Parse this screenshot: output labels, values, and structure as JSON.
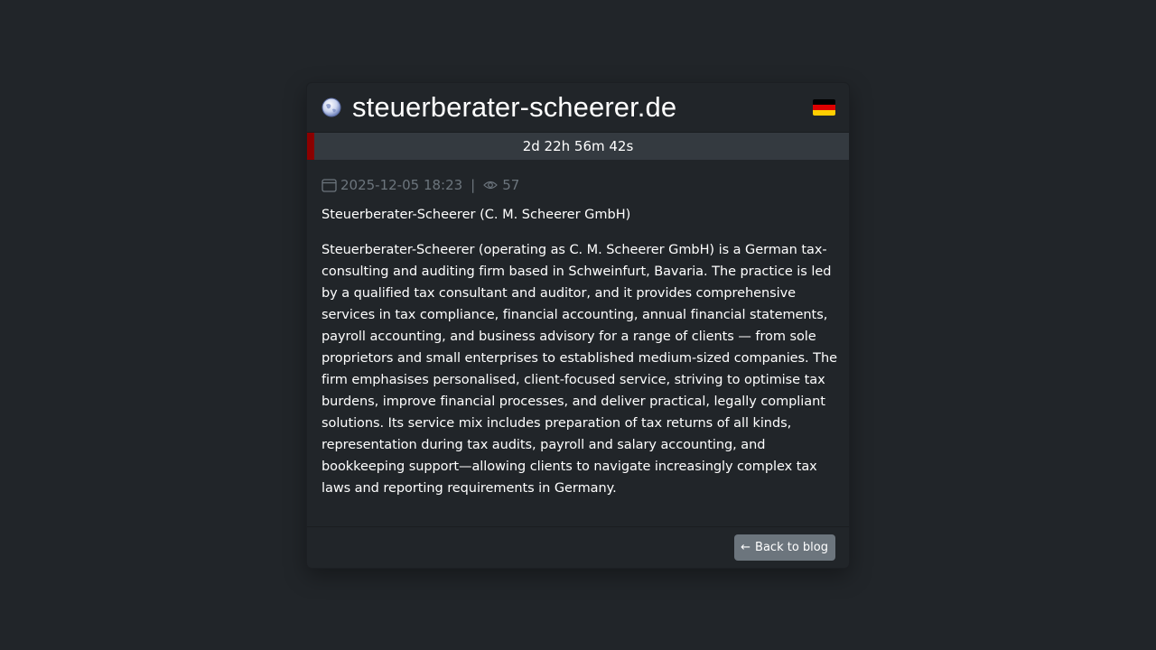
{
  "header": {
    "site_name": "steuerberater-scheerer.de",
    "globe_icon": "globe-icon",
    "country_flag": "de-flag-icon",
    "flag_colors": [
      "#000000",
      "#dd0000",
      "#ffce00"
    ]
  },
  "countdown": {
    "label": "2d 22h 56m 42s",
    "fill_fraction": 0.014,
    "fill_color": "#8b0000",
    "track_color": "#343a40"
  },
  "meta": {
    "date": "2025-12-05 18:23",
    "separator": "|",
    "views": "57"
  },
  "article": {
    "subtitle": "Steuerberater-Scheerer (C. M. Scheerer GmbH)",
    "description": "Steuerberater-Scheerer (operating as C. M. Scheerer GmbH) is a German tax-consulting and auditing firm based in Schweinfurt, Bavaria. The practice is led by a qualified tax consultant and auditor, and it provides comprehensive services in tax compliance, financial accounting, annual financial statements, payroll accounting, and business advisory for a range of clients — from sole proprietors and small enterprises to established medium-sized companies. The firm emphasises personalised, client-focused service, striving to optimise tax burdens, improve financial processes, and deliver practical, legally compliant solutions. Its service mix includes preparation of tax returns of all kinds, representation during tax audits, payroll and salary accounting, and bookkeeping support—allowing clients to navigate increasingly complex tax laws and reporting requirements in Germany."
  },
  "footer": {
    "back_arrow": "←",
    "back_label": "Back to blog"
  }
}
